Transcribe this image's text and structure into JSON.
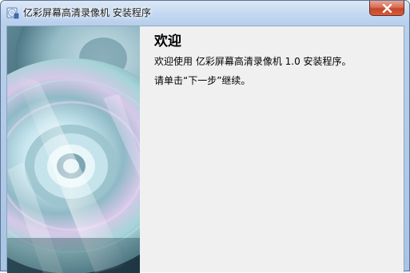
{
  "window": {
    "title": "亿彩屏幕高清录像机 安装程序",
    "app_icon": "installer-cd-icon",
    "close_icon": "close-icon"
  },
  "banner": {
    "image": "cd-disc-artwork"
  },
  "content": {
    "heading": "欢迎",
    "welcome_line": "欢迎使用 亿彩屏幕高清录像机 1.0 安装程序。",
    "instruction_line": "请单击“下一步”继续。"
  },
  "colors": {
    "client_bg": "#f0f0f0",
    "close_button": "#c7452a",
    "titlebar": "#c5d9f1"
  }
}
